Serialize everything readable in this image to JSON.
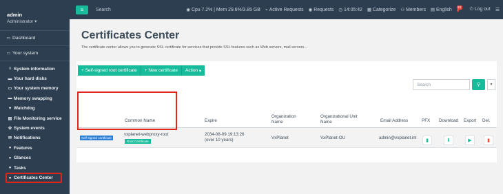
{
  "user": {
    "name": "admin",
    "role": "Administrator"
  },
  "sidebar": {
    "groups": [
      {
        "label": "Dashboard",
        "icon": "desktop-icon"
      },
      {
        "label": "Your system",
        "icon": "desktop-icon"
      }
    ],
    "items": [
      {
        "label": "System information",
        "icon": "list-icon"
      },
      {
        "label": "Your hard disks",
        "icon": "hdd-icon"
      },
      {
        "label": "Your system memory",
        "icon": "memory-icon"
      },
      {
        "label": "Memory swapping",
        "icon": "swap-icon"
      },
      {
        "label": "Watchdog",
        "icon": "heartbeat-icon"
      },
      {
        "label": "File Monitoring service",
        "icon": "file-icon"
      },
      {
        "label": "System events",
        "icon": "events-icon"
      },
      {
        "label": "Notifications",
        "icon": "envelope-icon"
      },
      {
        "label": "Features",
        "icon": "features-icon"
      },
      {
        "label": "Glances",
        "icon": "glances-icon"
      },
      {
        "label": "Tasks",
        "icon": "tasks-icon"
      },
      {
        "label": "Certificates Center",
        "icon": "dot-icon",
        "active": true
      }
    ]
  },
  "topbar": {
    "search_label": "Search",
    "stats": "Cpu 7.2% | Mem 29.6%/3.85 GB",
    "active_requests": "Active Requests",
    "requests": "Requests",
    "time": "14:05:42",
    "categorize": "Categorize",
    "members": "Members",
    "language": "English",
    "notification_count": "10",
    "logout": "Log out"
  },
  "page": {
    "title": "Certificates Center",
    "subtitle": "The certificate center allows you to generate SSL certificate for services that provide SSL features such as Web servers, mail servers..."
  },
  "actions": {
    "self_signed": "+ Self-signed root certificate",
    "new_certificate": "+ New certificate",
    "action": "Action"
  },
  "search": {
    "placeholder": "Search"
  },
  "table": {
    "columns": {
      "common_name": "Common Name",
      "expire": "Expire",
      "organization": "Organization Name",
      "org_unit": "Organizational Unit Name",
      "email": "Email Address",
      "pfx": "PFX",
      "download": "Download",
      "export": "Export",
      "delete": "Del."
    },
    "rows": [
      {
        "type_badge": "Self-signed certificate",
        "common_name": "vxplanet-webproxy-root",
        "root_badge": "Root Certificate",
        "expire": "2034-08-09 19:13:26 (over 10 years)",
        "organization": "VxPlanet",
        "org_unit": "VxPlanet-OU",
        "email": "admin@vxplanet.int"
      }
    ]
  },
  "colors": {
    "accent": "#18bc9c",
    "sidebar": "#2c3e50",
    "highlight": "#e0251b",
    "badge_blue": "#2b7fd7",
    "danger": "#e74c3c"
  }
}
